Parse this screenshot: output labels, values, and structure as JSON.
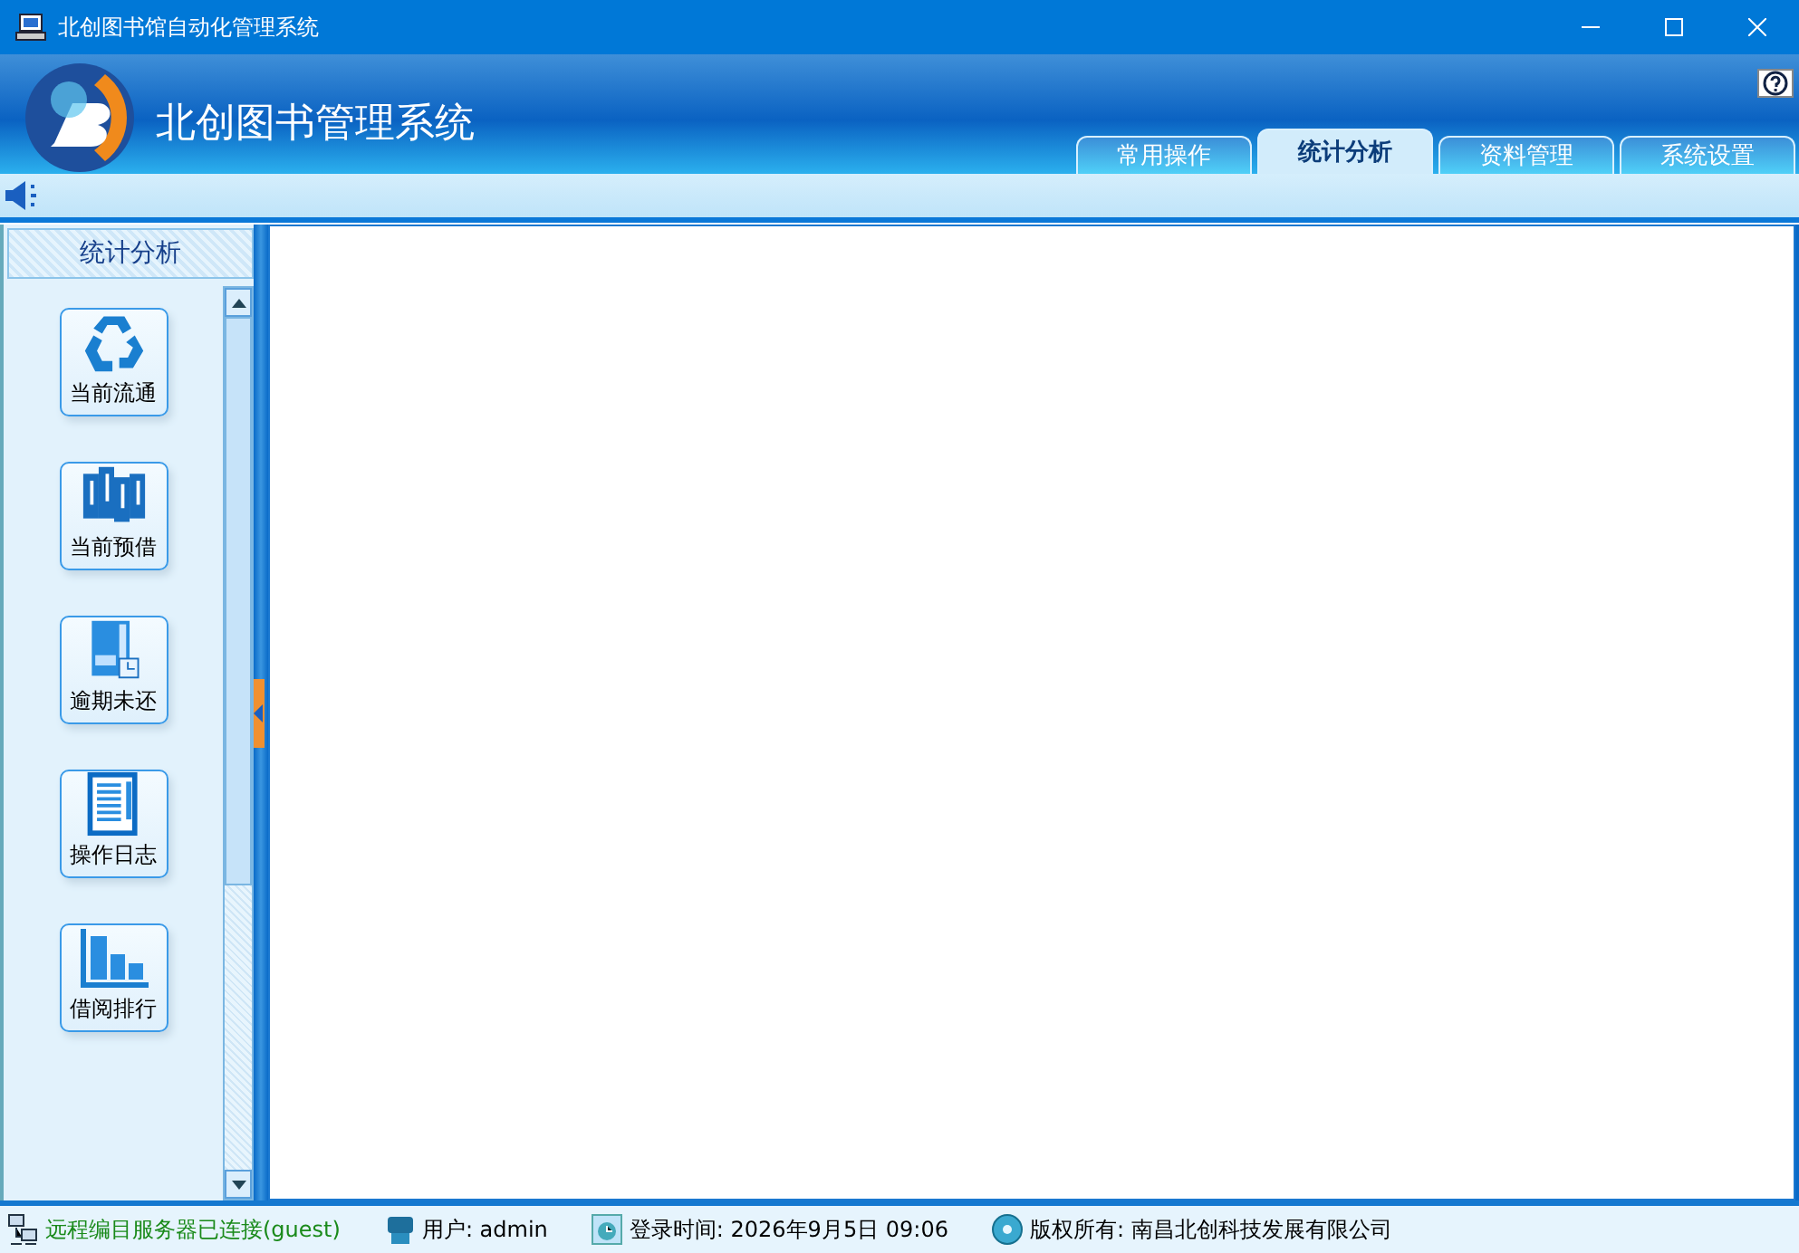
{
  "window": {
    "title": "北创图书馆自动化管理系统"
  },
  "banner": {
    "app_name": "北创图书管理系统"
  },
  "tabs": [
    {
      "label": "常用操作",
      "selected": false
    },
    {
      "label": "统计分析",
      "selected": true
    },
    {
      "label": "资料管理",
      "selected": false
    },
    {
      "label": "系统设置",
      "selected": false
    }
  ],
  "sidebar": {
    "title": "统计分析",
    "items": [
      {
        "label": "当前流通",
        "kind": "recycle"
      },
      {
        "label": "当前预借",
        "kind": "books"
      },
      {
        "label": "逾期未还",
        "kind": "overdue"
      },
      {
        "label": "操作日志",
        "kind": "log"
      },
      {
        "label": "借阅排行",
        "kind": "ranking"
      }
    ]
  },
  "status_bar": [
    {
      "kind": "connection",
      "text": "远程编目服务器已连接(guest)"
    },
    {
      "kind": "user",
      "text": "用户: admin"
    },
    {
      "kind": "login",
      "text": "登录时间: 2026年9月5日 09:06"
    },
    {
      "kind": "copyright",
      "text": "版权所有: 南昌北创科技发展有限公司"
    }
  ]
}
